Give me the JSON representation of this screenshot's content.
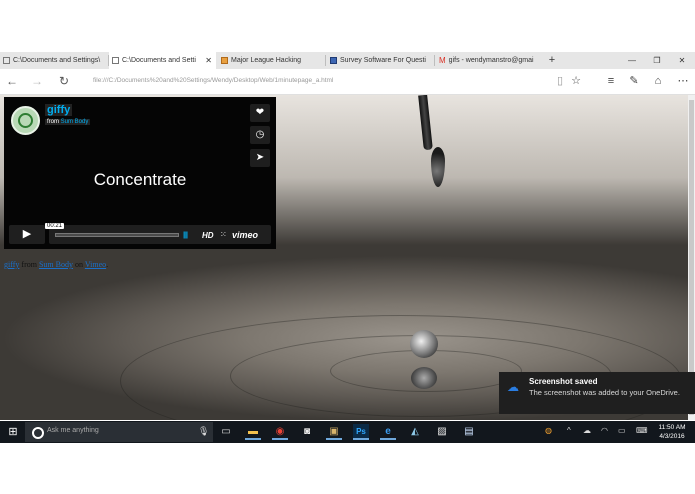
{
  "tabs": [
    {
      "title": "C:\\Documents and Settings\\",
      "active": false
    },
    {
      "title": "C:\\Documents and Setti",
      "active": true
    },
    {
      "title": "Major League Hacking",
      "active": false
    },
    {
      "title": "Survey Software For Questi",
      "active": false
    },
    {
      "title": "gifs - wendymanstro@gmai",
      "active": false
    }
  ],
  "new_tab_glyph": "+",
  "window_controls": {
    "minimize": "—",
    "restore": "❐",
    "close": "✕"
  },
  "address": {
    "url": "file:///C:/Documents%20and%20Settings/Wendy/Desktop/Web/1minutepage_a.html"
  },
  "video": {
    "title": "giffy",
    "byline_prefix": "from",
    "byline_author": "Sum Body",
    "center_text": "Concentrate",
    "timecode": "00:21",
    "hd_label": "HD",
    "brand": "vimeo",
    "icons": [
      "heart-icon",
      "clock-icon",
      "send-icon"
    ]
  },
  "caption": {
    "video_link": "giffy",
    "from": "from",
    "author_link": "Sum Body",
    "on": "on",
    "site_link": "Vimeo",
    "end": "."
  },
  "toast": {
    "title": "Screenshot saved",
    "body": "The screenshot was added to your OneDrive."
  },
  "taskbar": {
    "search_placeholder": "Ask me anything",
    "time": "11:50 AM",
    "date": "4/3/2016",
    "apps": [
      "task-view",
      "file-explorer",
      "chrome",
      "camera",
      "media",
      "photoshop",
      "edge",
      "paint",
      "photos",
      "notepad"
    ],
    "photoshop_label": "Ps"
  },
  "colors": {
    "vimeo_accent": "#00adef",
    "taskbar": "#12171d",
    "toast": "#1f1f1f"
  }
}
